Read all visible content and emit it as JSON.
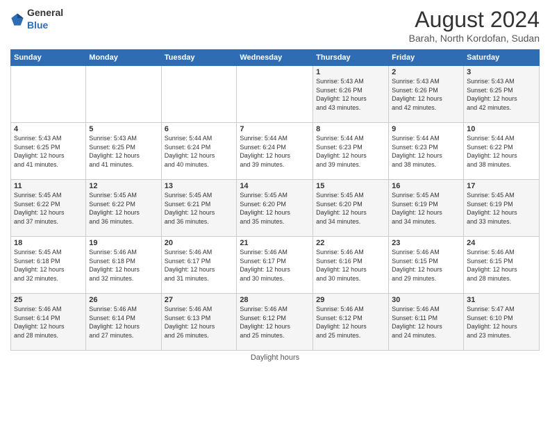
{
  "header": {
    "logo": {
      "general": "General",
      "blue": "Blue"
    },
    "title": "August 2024",
    "location": "Barah, North Kordofan, Sudan"
  },
  "days_of_week": [
    "Sunday",
    "Monday",
    "Tuesday",
    "Wednesday",
    "Thursday",
    "Friday",
    "Saturday"
  ],
  "weeks": [
    [
      {
        "day": "",
        "info": ""
      },
      {
        "day": "",
        "info": ""
      },
      {
        "day": "",
        "info": ""
      },
      {
        "day": "",
        "info": ""
      },
      {
        "day": "1",
        "info": "Sunrise: 5:43 AM\nSunset: 6:26 PM\nDaylight: 12 hours\nand 43 minutes."
      },
      {
        "day": "2",
        "info": "Sunrise: 5:43 AM\nSunset: 6:26 PM\nDaylight: 12 hours\nand 42 minutes."
      },
      {
        "day": "3",
        "info": "Sunrise: 5:43 AM\nSunset: 6:25 PM\nDaylight: 12 hours\nand 42 minutes."
      }
    ],
    [
      {
        "day": "4",
        "info": "Sunrise: 5:43 AM\nSunset: 6:25 PM\nDaylight: 12 hours\nand 41 minutes."
      },
      {
        "day": "5",
        "info": "Sunrise: 5:43 AM\nSunset: 6:25 PM\nDaylight: 12 hours\nand 41 minutes."
      },
      {
        "day": "6",
        "info": "Sunrise: 5:44 AM\nSunset: 6:24 PM\nDaylight: 12 hours\nand 40 minutes."
      },
      {
        "day": "7",
        "info": "Sunrise: 5:44 AM\nSunset: 6:24 PM\nDaylight: 12 hours\nand 39 minutes."
      },
      {
        "day": "8",
        "info": "Sunrise: 5:44 AM\nSunset: 6:23 PM\nDaylight: 12 hours\nand 39 minutes."
      },
      {
        "day": "9",
        "info": "Sunrise: 5:44 AM\nSunset: 6:23 PM\nDaylight: 12 hours\nand 38 minutes."
      },
      {
        "day": "10",
        "info": "Sunrise: 5:44 AM\nSunset: 6:22 PM\nDaylight: 12 hours\nand 38 minutes."
      }
    ],
    [
      {
        "day": "11",
        "info": "Sunrise: 5:45 AM\nSunset: 6:22 PM\nDaylight: 12 hours\nand 37 minutes."
      },
      {
        "day": "12",
        "info": "Sunrise: 5:45 AM\nSunset: 6:22 PM\nDaylight: 12 hours\nand 36 minutes."
      },
      {
        "day": "13",
        "info": "Sunrise: 5:45 AM\nSunset: 6:21 PM\nDaylight: 12 hours\nand 36 minutes."
      },
      {
        "day": "14",
        "info": "Sunrise: 5:45 AM\nSunset: 6:20 PM\nDaylight: 12 hours\nand 35 minutes."
      },
      {
        "day": "15",
        "info": "Sunrise: 5:45 AM\nSunset: 6:20 PM\nDaylight: 12 hours\nand 34 minutes."
      },
      {
        "day": "16",
        "info": "Sunrise: 5:45 AM\nSunset: 6:19 PM\nDaylight: 12 hours\nand 34 minutes."
      },
      {
        "day": "17",
        "info": "Sunrise: 5:45 AM\nSunset: 6:19 PM\nDaylight: 12 hours\nand 33 minutes."
      }
    ],
    [
      {
        "day": "18",
        "info": "Sunrise: 5:45 AM\nSunset: 6:18 PM\nDaylight: 12 hours\nand 32 minutes."
      },
      {
        "day": "19",
        "info": "Sunrise: 5:46 AM\nSunset: 6:18 PM\nDaylight: 12 hours\nand 32 minutes."
      },
      {
        "day": "20",
        "info": "Sunrise: 5:46 AM\nSunset: 6:17 PM\nDaylight: 12 hours\nand 31 minutes."
      },
      {
        "day": "21",
        "info": "Sunrise: 5:46 AM\nSunset: 6:17 PM\nDaylight: 12 hours\nand 30 minutes."
      },
      {
        "day": "22",
        "info": "Sunrise: 5:46 AM\nSunset: 6:16 PM\nDaylight: 12 hours\nand 30 minutes."
      },
      {
        "day": "23",
        "info": "Sunrise: 5:46 AM\nSunset: 6:15 PM\nDaylight: 12 hours\nand 29 minutes."
      },
      {
        "day": "24",
        "info": "Sunrise: 5:46 AM\nSunset: 6:15 PM\nDaylight: 12 hours\nand 28 minutes."
      }
    ],
    [
      {
        "day": "25",
        "info": "Sunrise: 5:46 AM\nSunset: 6:14 PM\nDaylight: 12 hours\nand 28 minutes."
      },
      {
        "day": "26",
        "info": "Sunrise: 5:46 AM\nSunset: 6:14 PM\nDaylight: 12 hours\nand 27 minutes."
      },
      {
        "day": "27",
        "info": "Sunrise: 5:46 AM\nSunset: 6:13 PM\nDaylight: 12 hours\nand 26 minutes."
      },
      {
        "day": "28",
        "info": "Sunrise: 5:46 AM\nSunset: 6:12 PM\nDaylight: 12 hours\nand 25 minutes."
      },
      {
        "day": "29",
        "info": "Sunrise: 5:46 AM\nSunset: 6:12 PM\nDaylight: 12 hours\nand 25 minutes."
      },
      {
        "day": "30",
        "info": "Sunrise: 5:46 AM\nSunset: 6:11 PM\nDaylight: 12 hours\nand 24 minutes."
      },
      {
        "day": "31",
        "info": "Sunrise: 5:47 AM\nSunset: 6:10 PM\nDaylight: 12 hours\nand 23 minutes."
      }
    ]
  ],
  "footer": "Daylight hours"
}
